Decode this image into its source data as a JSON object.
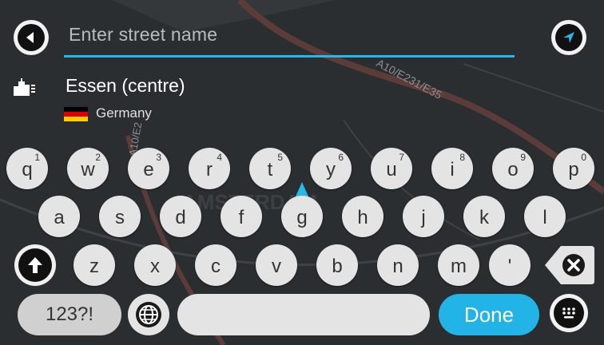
{
  "search": {
    "placeholder": "Enter street name"
  },
  "result": {
    "title": "Essen (centre)",
    "country": "Germany",
    "flag_colors": [
      "#000000",
      "#dd0000",
      "#ffce00"
    ]
  },
  "map": {
    "label": "AMSTERDAM",
    "road_label": "A10/E231/E35",
    "road_label2": "A10/E2"
  },
  "keyboard": {
    "row1": [
      {
        "letter": "q",
        "alt": "1"
      },
      {
        "letter": "w",
        "alt": "2"
      },
      {
        "letter": "e",
        "alt": "3"
      },
      {
        "letter": "r",
        "alt": "4"
      },
      {
        "letter": "t",
        "alt": "5"
      },
      {
        "letter": "y",
        "alt": "6"
      },
      {
        "letter": "u",
        "alt": "7"
      },
      {
        "letter": "i",
        "alt": "8"
      },
      {
        "letter": "o",
        "alt": "9"
      },
      {
        "letter": "p",
        "alt": "0"
      }
    ],
    "row2": [
      "a",
      "s",
      "d",
      "f",
      "g",
      "h",
      "j",
      "k",
      "l"
    ],
    "row3": [
      "z",
      "x",
      "c",
      "v",
      "b",
      "n",
      "m",
      "'"
    ],
    "symbols_label": "123?!",
    "done_label": "Done"
  },
  "colors": {
    "accent": "#22b4e6",
    "key_bg": "#e4e4e4",
    "underline": "#26b8e6"
  }
}
